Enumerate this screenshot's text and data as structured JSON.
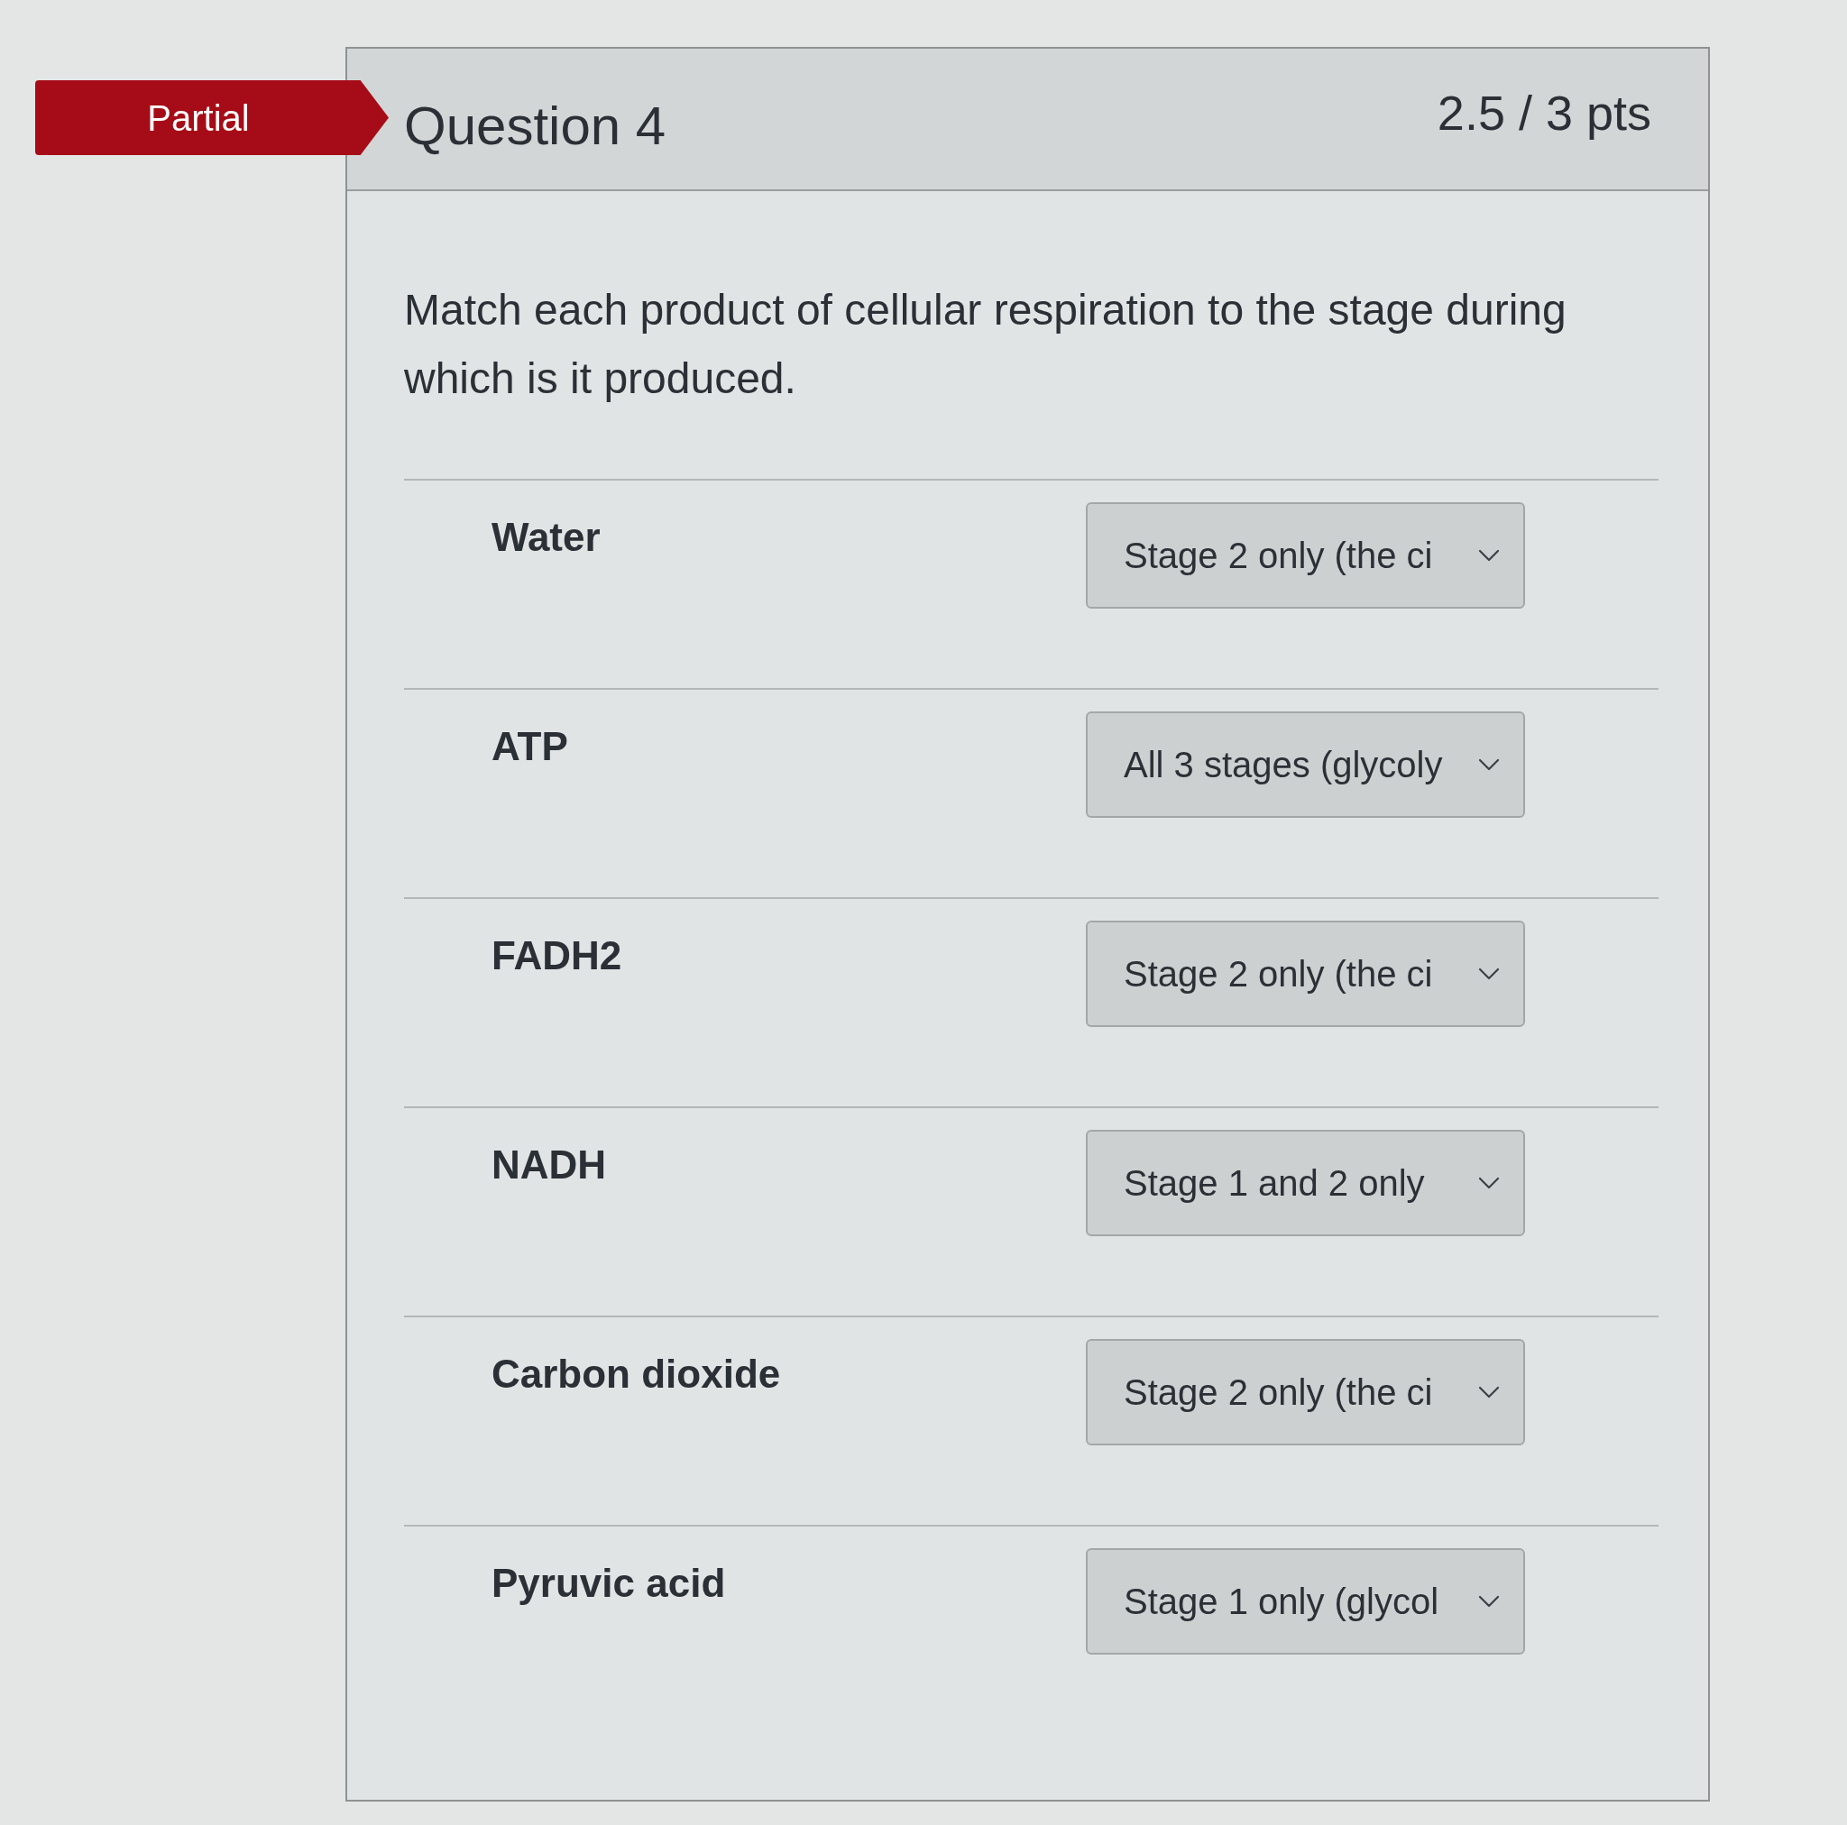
{
  "status_badge": {
    "label": "Partial"
  },
  "question": {
    "title": "Question 4",
    "points": "2.5 / 3 pts",
    "prompt": "Match each product of cellular respiration to the stage during which is it produced.",
    "matches": [
      {
        "term": "Water",
        "answer": "Stage 2 only (the ci"
      },
      {
        "term": "ATP",
        "answer": "All 3 stages (glycoly"
      },
      {
        "term": "FADH2",
        "answer": "Stage 2 only (the ci"
      },
      {
        "term": "NADH",
        "answer": "Stage 1 and 2 only"
      },
      {
        "term": "Carbon dioxide",
        "answer": "Stage 2 only (the ci"
      },
      {
        "term": "Pyruvic acid",
        "answer": "Stage 1 only (glycol"
      }
    ]
  }
}
